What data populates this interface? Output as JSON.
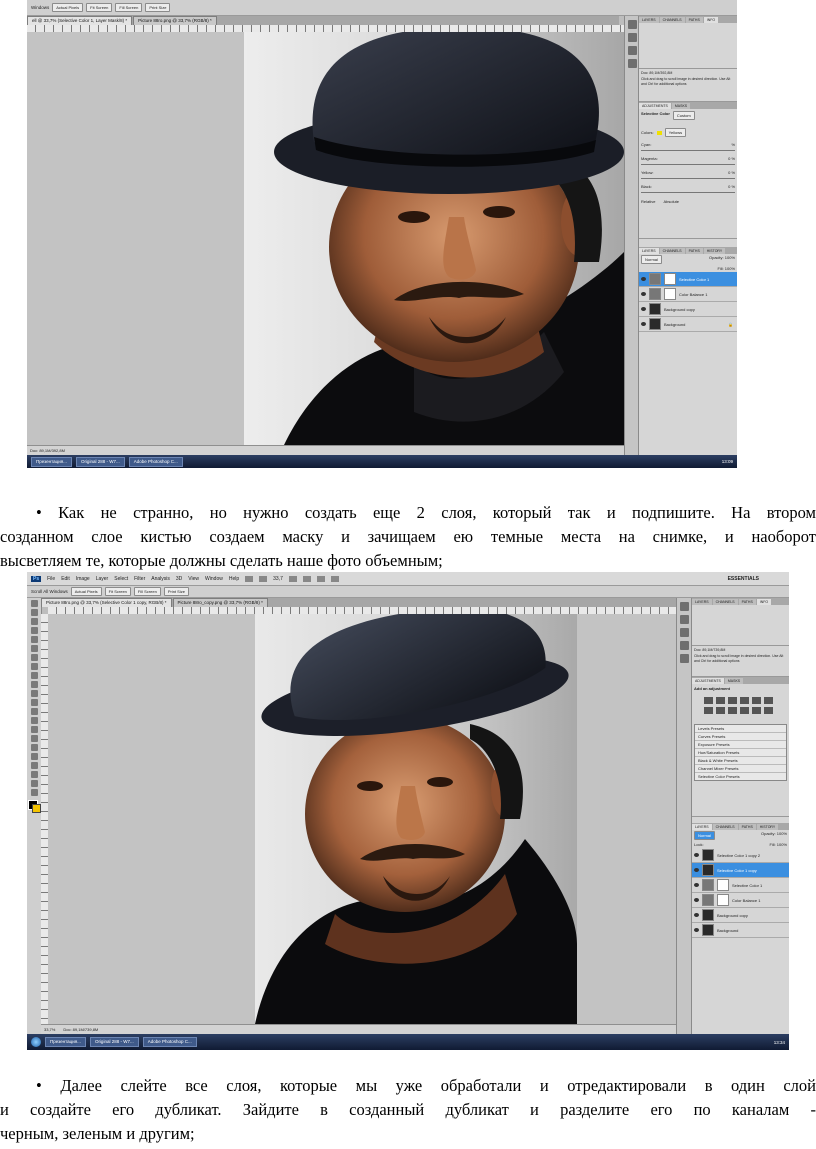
{
  "screenshot1": {
    "menu": [],
    "option_buttons": [
      "Actual Pixels",
      "Fit Screen",
      "Fill Screen",
      "Print Size"
    ],
    "option_prefix": "Windows",
    "doc_tabs": [
      "ell @ 33,7% (Selective Color 1, Layer Mask/8) *",
      "Picture 88ro.png @ 33,7% (RGB/8) *"
    ],
    "status": "Doc: 89,1M/392,8M",
    "panel_tabs": [
      "LAYERS",
      "CHANNELS",
      "PATHS",
      "INFO"
    ],
    "info_text": "Click and drag to scroll image in desired direction. Use Alt and Ctrl for additional options",
    "doc_info": "Doc: 89,1M/392,8M",
    "adjustments_tabs": [
      "ADJUSTMENTS",
      "MASKS"
    ],
    "adjustment_title": "Selective Color",
    "adjustment_preset": "Custom",
    "colors_label": "Colors:",
    "colors_value": "Yellows",
    "sliders": [
      {
        "label": "Cyan:",
        "value": "",
        "unit": "%"
      },
      {
        "label": "Magenta:",
        "value": "0",
        "unit": "%"
      },
      {
        "label": "Yellow:",
        "value": "0",
        "unit": "%"
      },
      {
        "label": "Black:",
        "value": "0",
        "unit": "%"
      }
    ],
    "method": [
      "Relative",
      "Absolute"
    ],
    "layers_tabs": [
      "LAYERS",
      "CHANNELS",
      "PATHS",
      "HISTORY"
    ],
    "blend_mode": "Normal",
    "opacity": "Opacity: 100%",
    "fill": "Fill: 100%",
    "layers": [
      {
        "name": "Selective Color 1",
        "selected": true
      },
      {
        "name": "Color Balance 1",
        "selected": false
      },
      {
        "name": "Background copy",
        "selected": false
      },
      {
        "name": "Background",
        "selected": false
      }
    ],
    "taskbar_items": [
      "Презентация...",
      "Original 288 - W7...",
      "Adobe Photoshop C..."
    ],
    "clock": "13:09"
  },
  "paragraph1": {
    "bullet": "•",
    "lines": [
      "Как не странно, но нужно создать еще 2 слоя, который так и подпишите. На втором",
      "созданном слое кистью создаем маску и зачищаем ею темные места на снимке, и наоборот",
      "высветляем те, которые должны сделать наше фото объемным;"
    ]
  },
  "screenshot2": {
    "menu": [
      "Ps",
      "File",
      "Edit",
      "Image",
      "Layer",
      "Select",
      "Filter",
      "Analysis",
      "3D",
      "View",
      "Window",
      "Help"
    ],
    "zoom": "33,7",
    "workspace": "ESSENTIALS",
    "option_prefix": "Scroll All Windows",
    "option_buttons": [
      "Actual Pixels",
      "Fit Screen",
      "Fill Screen",
      "Print Size"
    ],
    "doc_tabs": [
      "Picture 88ro.png @ 33,7% (Selective Color 1 copy, RGB/8) *",
      "Picture 88ro_copy.png @ 33,7% (RGB/8) *"
    ],
    "status_zoom": "33,7%",
    "status": "Doc: 89,1M/739,8M",
    "panel_tabs": [
      "LAYERS",
      "CHANNELS",
      "PATHS",
      "INFO"
    ],
    "info_text": "Click and drag to scroll image in desired direction. Use Alt and Ctrl for additional options",
    "doc_info": "Doc: 89,1M/739,8M",
    "adjustments_tabs": [
      "ADJUSTMENTS",
      "MASKS"
    ],
    "adjustment_title": "Add an adjustment",
    "presets": [
      "Levels Presets",
      "Curves Presets",
      "Exposure Presets",
      "Hue/Saturation Presets",
      "Black & White Presets",
      "Channel Mixer Presets",
      "Selective Color Presets"
    ],
    "layers_tabs": [
      "LAYERS",
      "CHANNELS",
      "PATHS",
      "HISTORY"
    ],
    "blend_mode": "Normal",
    "opacity": "Opacity: 100%",
    "lock": "Lock:",
    "fill": "Fill: 100%",
    "layers": [
      {
        "name": "Selective Color 1 copy 2",
        "selected": false
      },
      {
        "name": "Selective Color 1 copy",
        "selected": true
      },
      {
        "name": "Selective Color 1",
        "selected": false
      },
      {
        "name": "Color Balance 1",
        "selected": false
      },
      {
        "name": "Background copy",
        "selected": false
      },
      {
        "name": "Background",
        "selected": false
      }
    ],
    "taskbar_items": [
      "Презентация...",
      "Original 288 - W7...",
      "Adobe Photoshop C..."
    ],
    "clock": "13:34"
  },
  "paragraph2": {
    "bullet": "•",
    "lines": [
      "Далее слейте все слоя, которые мы уже обработали и отредактировали в один слой",
      "и создайте его дубликат. Зайдите в созданный дубликат и разделите его по каналам -",
      "черным, зеленым и другим;"
    ]
  }
}
